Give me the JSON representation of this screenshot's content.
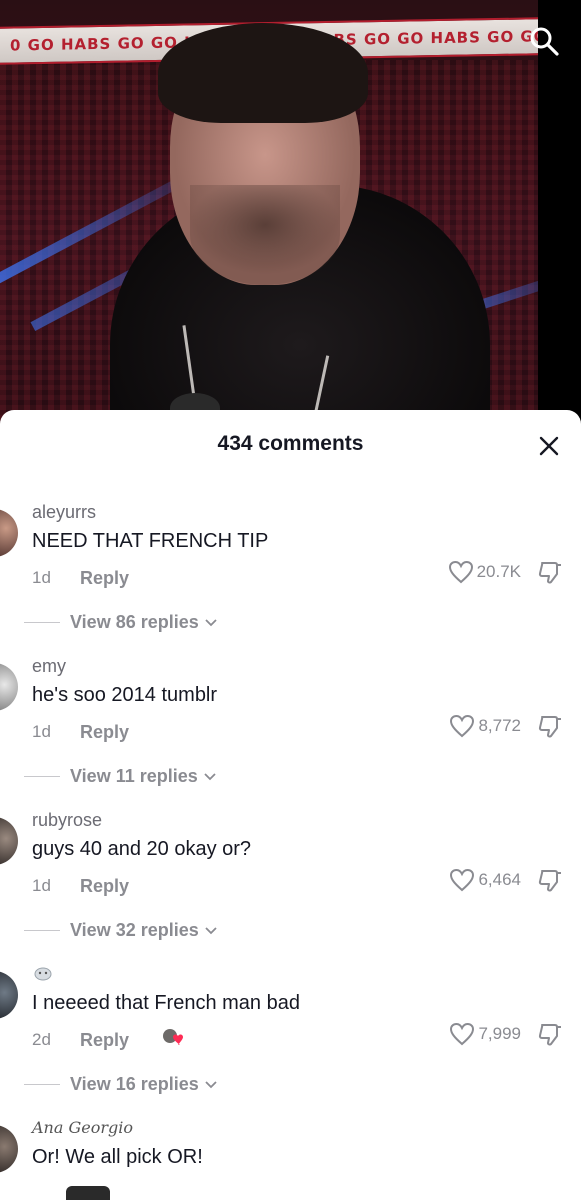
{
  "video": {
    "banner_text": "0  GO HABS GO  GO HABS GO  GO HABS GO  GO HABS GO  GO HABS GO",
    "search_icon": "search-icon"
  },
  "panel": {
    "comment_count_label": "434 comments",
    "close_icon": "close-icon"
  },
  "comments": [
    {
      "username": "aleyurrs",
      "text": "NEED THAT FRENCH TIP",
      "time": "1d",
      "reply_label": "Reply",
      "likes": "20.7K",
      "view_replies": "View 86 replies"
    },
    {
      "username": "emy",
      "text": "he's soo 2014 tumblr",
      "time": "1d",
      "reply_label": "Reply",
      "likes": "8,772",
      "view_replies": "View 11 replies"
    },
    {
      "username": "rubyrose",
      "text": "guys 40 and 20 okay or?",
      "time": "1d",
      "reply_label": "Reply",
      "likes": "6,464",
      "view_replies": "View 32 replies"
    },
    {
      "username": "",
      "text": "I neeeed that French man bad",
      "time": "2d",
      "reply_label": "Reply",
      "likes": "7,999",
      "view_replies": "View 16 replies"
    },
    {
      "username": "Ana Georgio",
      "text": "Or! We all pick OR!"
    }
  ],
  "colors": {
    "text_primary": "#161823",
    "text_secondary": "#8a8b91",
    "creator_heart": "#fe2c55"
  }
}
